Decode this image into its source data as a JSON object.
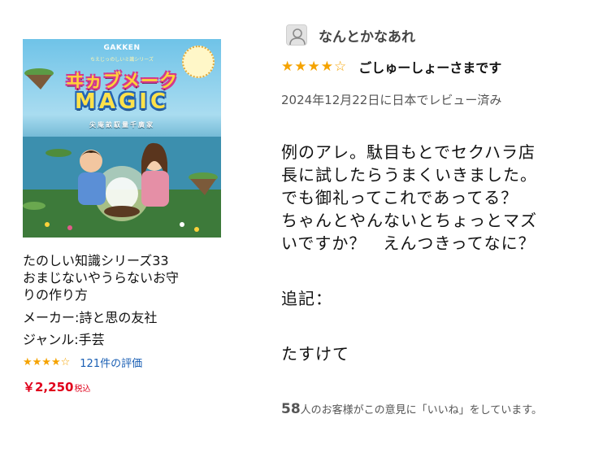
{
  "product": {
    "cover": {
      "brand": "GAKKEN",
      "series_text": "ちえじっのしいミ識シリーズ",
      "title": "ヰヵブメーク",
      "title_magic": "MAGIC",
      "subtitle": "尖庵畝馭量千廣家"
    },
    "name": "たのしい知識シリーズ33\nおまじないやうらないお守\nりの作り方",
    "maker": "メーカー:詩と思の友社",
    "genre": "ジャンル:手芸",
    "stars_filled": "★★★★",
    "stars_empty": "☆",
    "rating": 4,
    "review_count_text": "121件の評価",
    "price": "￥2,250",
    "price_tax": "税込"
  },
  "review": {
    "reviewer_name": "なんとかなあれ",
    "stars_filled": "★★★★",
    "stars_empty": "☆",
    "rating": 4,
    "title": "ごしゅーしょーさまです",
    "date": "2024年12月22日に日本でレビュー済み",
    "body": "例のアレ。駄目もとでセクハラ店\n長に試したらうまくいきました。\nでも御礼ってこれであってる？\nちゃんとやんないとちょっとマズ\nいですか？　えんつきってなに？",
    "postscript_label": "追記：",
    "postscript": "たすけて",
    "helpful_count": "58",
    "helpful_text": "人のお客様がこの意見に「いいね」をしています。"
  },
  "colors": {
    "star": "#f5a300",
    "price": "#e0001b",
    "link": "#1a5fb4"
  },
  "icons": {
    "avatar": "default-user-avatar-icon"
  }
}
